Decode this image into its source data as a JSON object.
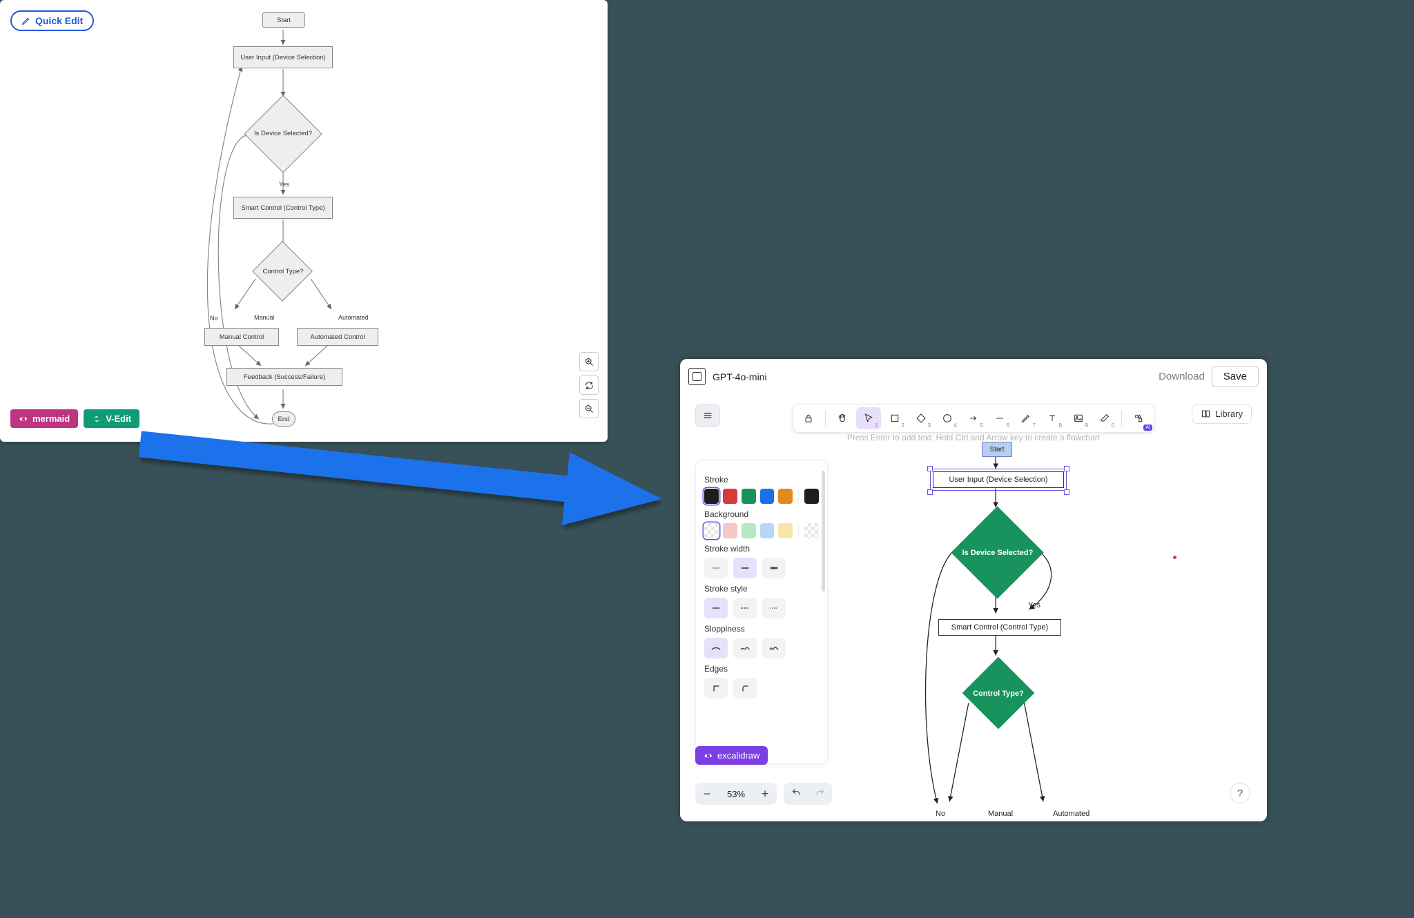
{
  "left_panel": {
    "quick_edit_label": "Quick Edit",
    "badges": {
      "mermaid": "mermaid",
      "vedit": "V-Edit"
    },
    "flow": {
      "start": "Start",
      "user_input": "User Input (Device Selection)",
      "is_selected": "Is Device Selected?",
      "yes": "Yes",
      "no": "No",
      "smart_control": "Smart Control (Control Type)",
      "control_type": "Control Type?",
      "manual": "Manual",
      "automated": "Automated",
      "manual_control": "Manual Control",
      "automated_control": "Automated Control",
      "feedback": "Feedback (Success/Failure)",
      "end": "End"
    }
  },
  "right_panel": {
    "model_name": "GPT-4o-mini",
    "download": "Download",
    "save": "Save",
    "library": "Library",
    "hint_text": "Press Enter to add text. Hold Ctrl and Arrow key to create a flowchart",
    "toolbar_nums": {
      "selection": "1",
      "rect": "2",
      "diamond": "3",
      "ellipse": "4",
      "arrow": "5",
      "line": "6",
      "draw": "7",
      "text": "8",
      "image": "9",
      "eraser": "0"
    },
    "props": {
      "stroke_label": "Stroke",
      "background_label": "Background",
      "stroke_width_label": "Stroke width",
      "stroke_style_label": "Stroke style",
      "sloppiness_label": "Sloppiness",
      "edges_label": "Edges",
      "stroke_colors": [
        "#1e1e1e",
        "#d83a3a",
        "#18935e",
        "#1f6feb",
        "#e08a1e"
      ],
      "current_stroke": "#1e1e1e",
      "bg_colors": [
        "transparent",
        "#f7c6c6",
        "#b8e7c3",
        "#b7d8f5",
        "#f7e6a8"
      ],
      "current_bg": "transparent"
    },
    "zoom_value": "53%",
    "excalidraw_label": "excalidraw",
    "flow": {
      "start": "Start",
      "user_input": "User Input (Device Selection)",
      "is_selected": "Is Device Selected?",
      "yes": "Yes",
      "no": "No",
      "smart_control": "Smart Control (Control Type)",
      "control_type": "Control Type?",
      "manual": "Manual",
      "automated": "Automated"
    }
  }
}
